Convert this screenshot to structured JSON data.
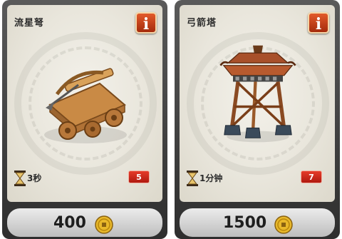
{
  "cards": [
    {
      "name": "流星弩",
      "info_label": "i",
      "build_time": "3秒",
      "badge": "5",
      "price": "400",
      "art_icon": "ballista-icon"
    },
    {
      "name": "弓箭塔",
      "info_label": "i",
      "build_time": "1分钟",
      "badge": "7",
      "price": "1500",
      "art_icon": "archer-tower-icon"
    }
  ],
  "colors": {
    "info_button": "#c23c14",
    "badge": "#d42a1c",
    "coin": "#e8b82a"
  }
}
